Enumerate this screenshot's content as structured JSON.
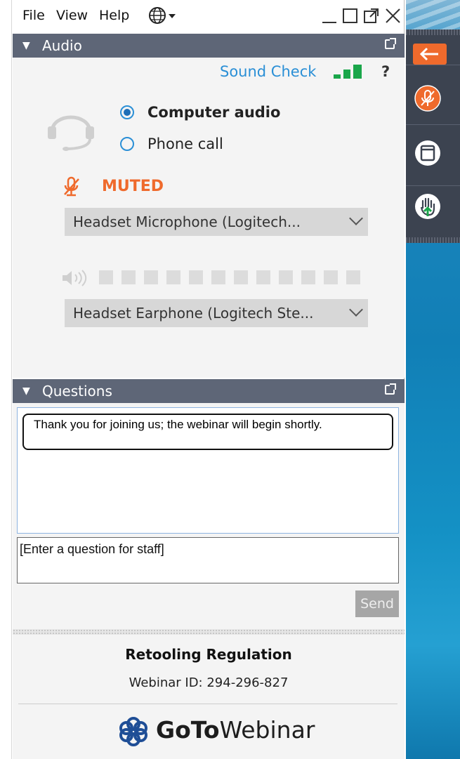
{
  "menu": {
    "file": "File",
    "view": "View",
    "help": "Help"
  },
  "icons": {
    "globe": "globe-icon",
    "minimize": "minimize-icon",
    "maximize": "maximize-icon",
    "popout": "popout-icon",
    "close": "close-icon",
    "headset": "headset-icon",
    "mic_muted": "muted-microphone-icon",
    "speaker": "speaker-icon"
  },
  "audio": {
    "title": "Audio",
    "sound_check": "Sound Check",
    "help": "?",
    "option_computer": "Computer audio",
    "option_phone": "Phone call",
    "selected_option": "Computer audio",
    "status": "MUTED",
    "microphone": "Headset Microphone (Logitech...",
    "speaker": "Headset Earphone (Logitech Ste..."
  },
  "questions": {
    "title": "Questions",
    "message": "Thank you for joining us; the webinar will begin shortly.",
    "placeholder": "[Enter a question for staff]",
    "send": "Send"
  },
  "footer": {
    "title": "Retooling Regulation",
    "webinar_id": "Webinar ID: 294-296-827",
    "brand_goto": "GoTo",
    "brand_webinar": "Webinar"
  },
  "colors": {
    "header": "#5e6677",
    "accent_blue": "#2a8fd6",
    "muted_orange": "#ef6a2c",
    "signal_green": "#1aa64a",
    "toolbar": "#3c4350"
  }
}
